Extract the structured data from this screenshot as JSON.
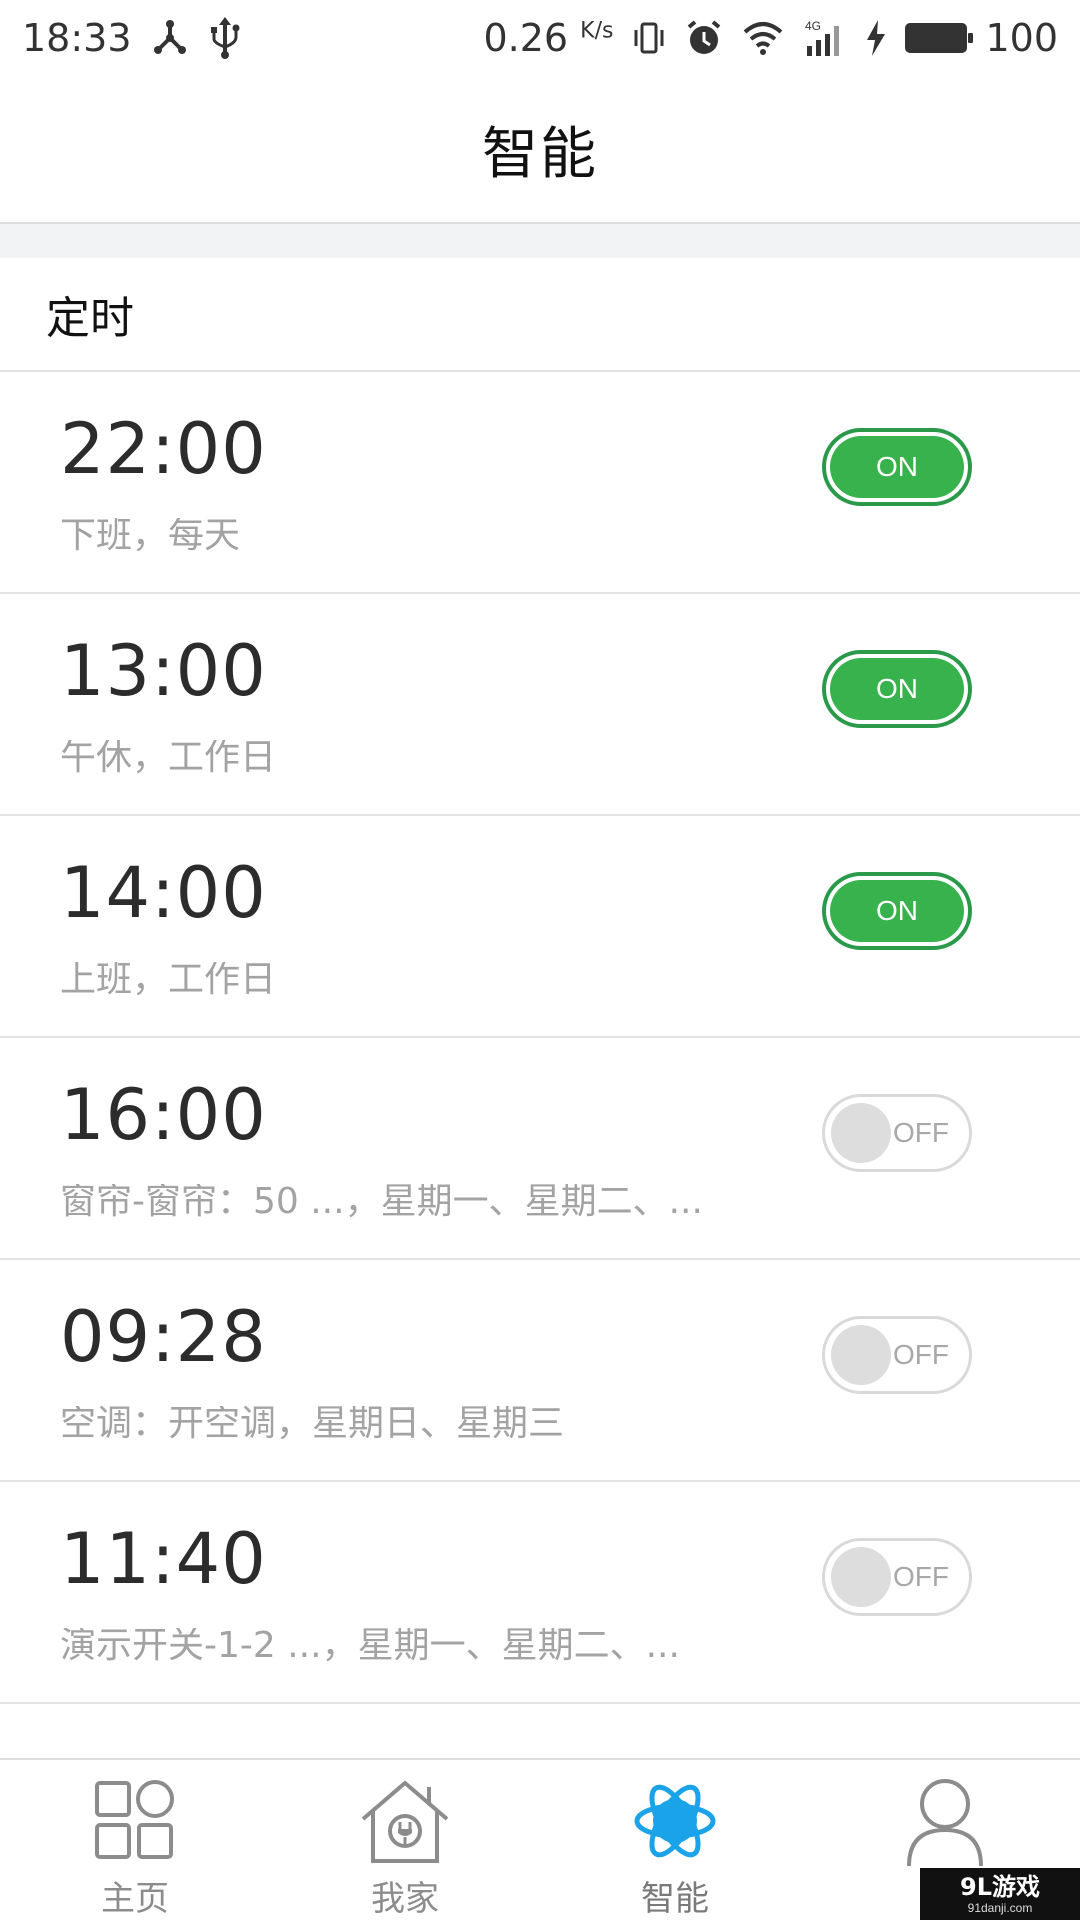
{
  "status_bar": {
    "time": "18:33",
    "net_speed": "0.26",
    "net_speed_unit": "K/s",
    "network_type": "4G",
    "battery_level": "100",
    "icons": [
      "share-icon",
      "usb-icon",
      "vibrate-icon",
      "alarm-icon",
      "wifi-icon",
      "signal-icon",
      "charging-icon",
      "battery-icon"
    ]
  },
  "header": {
    "title": "智能"
  },
  "section": {
    "title": "定时"
  },
  "timers": [
    {
      "time": "22:00",
      "desc": "下班，每天",
      "state": "on",
      "label": "ON"
    },
    {
      "time": "13:00",
      "desc": "午休，工作日",
      "state": "on",
      "label": "ON"
    },
    {
      "time": "14:00",
      "desc": "上班，工作日",
      "state": "on",
      "label": "ON"
    },
    {
      "time": "16:00",
      "desc": "窗帘-窗帘：50 ...，星期一、星期二、...",
      "state": "off",
      "label": "OFF"
    },
    {
      "time": "09:28",
      "desc": "空调：开空调，星期日、星期三",
      "state": "off",
      "label": "OFF"
    },
    {
      "time": "11:40",
      "desc": "演示开关-1-2 ...，星期一、星期二、...",
      "state": "off",
      "label": "OFF"
    }
  ],
  "bottom_nav": {
    "items": [
      {
        "label": "主页",
        "icon": "grid-home-icon",
        "active": false
      },
      {
        "label": "我家",
        "icon": "house-plug-icon",
        "active": false
      },
      {
        "label": "智能",
        "icon": "atom-smart-icon",
        "active": true
      },
      {
        "label": "我",
        "icon": "person-icon",
        "active": false
      }
    ]
  },
  "colors": {
    "toggle_on": "#37b24d",
    "toggle_on_border": "#2a9a4a",
    "toggle_off": "#dddddd",
    "active_nav_icon": "#1aa3e8",
    "inactive_nav_icon": "#8c8c8c"
  },
  "watermark": {
    "main": "9L游戏",
    "sub": "91danji.com"
  }
}
